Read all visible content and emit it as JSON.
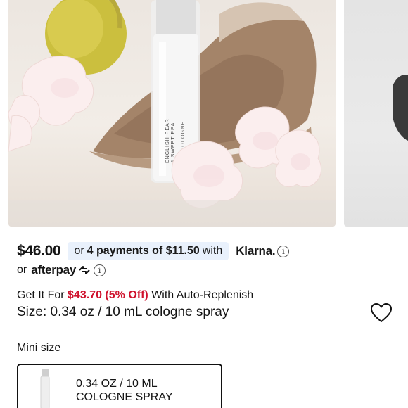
{
  "product_image": {
    "bottle_text": [
      "ENGLISH PEAR",
      "& SWEET PEA",
      "COLOGNE"
    ]
  },
  "price": {
    "amount": "$46.00",
    "installment_prefix": "or",
    "installment_bold": "4 payments of $11.50",
    "installment_suffix": "with",
    "klarna_label": "Klarna.",
    "afterpay_prefix": "or",
    "afterpay_label": "afterpay",
    "info_glyph": "i"
  },
  "replenish": {
    "prefix": "Get It For",
    "discount_price": "$43.70 (5% Off)",
    "suffix": "With Auto-Replenish"
  },
  "size": {
    "line": "Size: 0.34 oz / 10 mL cologne spray"
  },
  "size_options": {
    "section_label": "Mini size",
    "selected": {
      "line1": "0.34 OZ / 10 ML",
      "line2": "COLOGNE SPRAY"
    }
  },
  "colors": {
    "installment_bg": "#e9f1fc",
    "discount_red": "#cf112c",
    "text": "#151515"
  },
  "icons": [
    "info-icon",
    "afterpay-logo-icon",
    "heart-icon"
  ]
}
